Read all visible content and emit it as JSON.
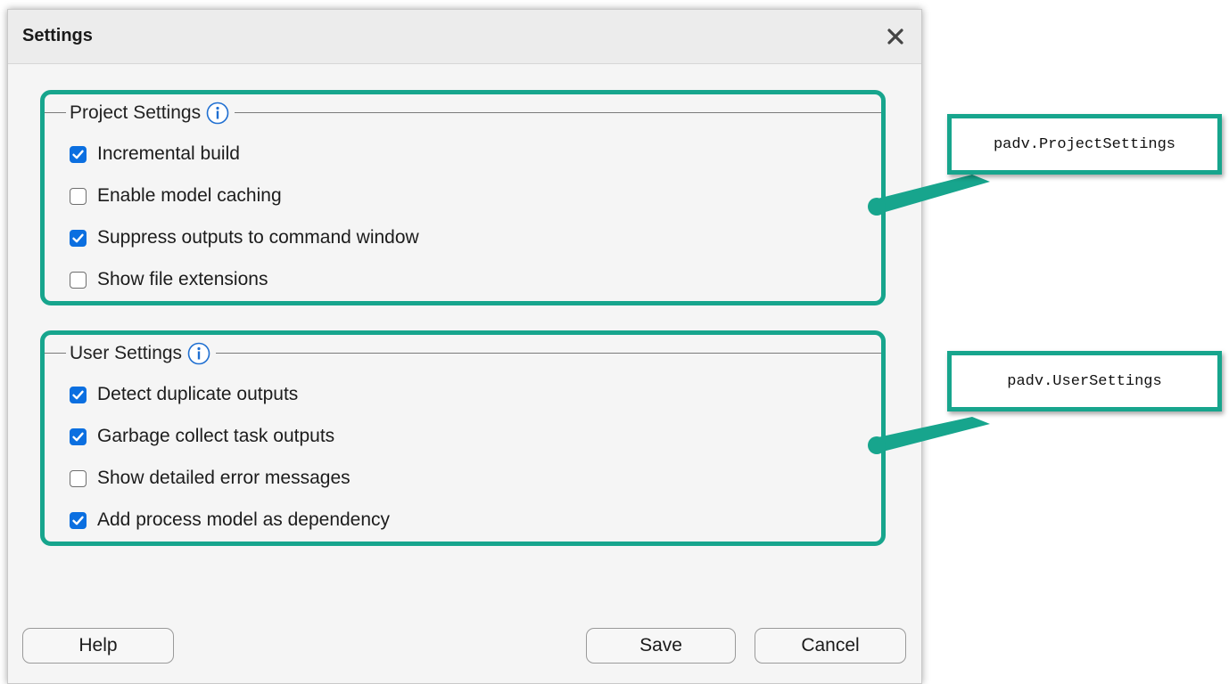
{
  "dialog": {
    "title": "Settings",
    "close_icon": "close-icon"
  },
  "project_settings": {
    "legend": "Project Settings",
    "info_icon": "info-icon",
    "items": [
      {
        "label": "Incremental build",
        "checked": true
      },
      {
        "label": "Enable model caching",
        "checked": false
      },
      {
        "label": "Suppress outputs to command window",
        "checked": true
      },
      {
        "label": "Show file extensions",
        "checked": false
      }
    ]
  },
  "user_settings": {
    "legend": "User Settings",
    "info_icon": "info-icon",
    "items": [
      {
        "label": "Detect duplicate outputs",
        "checked": true
      },
      {
        "label": "Garbage collect task outputs",
        "checked": true
      },
      {
        "label": "Show detailed error messages",
        "checked": false
      },
      {
        "label": "Add process model as dependency",
        "checked": true
      }
    ]
  },
  "buttons": {
    "help": "Help",
    "save": "Save",
    "cancel": "Cancel"
  },
  "callouts": {
    "project": "padv.ProjectSettings",
    "user": "padv.UserSettings"
  },
  "colors": {
    "annotation_accent": "#17a58d",
    "checkbox_checked": "#0b6fe0",
    "info_icon": "#1f6fd1"
  }
}
